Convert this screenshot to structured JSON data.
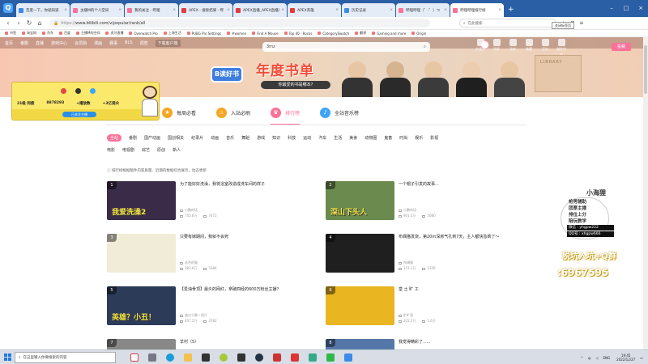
{
  "browser": {
    "tabs": [
      {
        "label": "百度一下，你就知道",
        "fav": "blue"
      },
      {
        "label": "主播M的个人空间",
        "fav": "pink"
      },
      {
        "label": "我的关注 - 哔哩",
        "fav": "pink"
      },
      {
        "label": "APEX - 搜索结果 - 哔",
        "fav": "red"
      },
      {
        "label": "APEX直播_APEX直播间",
        "fav": "red"
      },
      {
        "label": "APEX英雄",
        "fav": "red"
      },
      {
        "label": "历史记录",
        "fav": "blue"
      },
      {
        "label": "哔哩哔哩（゜-゜）つ",
        "fav": "pink"
      },
      {
        "label": "哔哩哔哩排行榜",
        "fav": "pink",
        "active": true
      }
    ],
    "tooltip": "关闭标签页",
    "address_protocol": "https://",
    "address_rest": "www.bilibili.com/v/popular/rank/all",
    "search_placeholder": "在此搜索",
    "bookmarks": [
      "书签",
      "淘宝网",
      "京东",
      "百度",
      "主播M的空间",
      "虎牙直播",
      "Overwatch Pro",
      "上海生活",
      "PUBG Pro Settings",
      "#women",
      "Find A Mouse",
      "Top 40 - Rocks",
      "CategorySwatch",
      "翻译",
      "Gaming and more",
      "Origin"
    ]
  },
  "bili": {
    "nav": [
      "首页",
      "番剧",
      "直播",
      "游戏中心",
      "会员购",
      "漫画",
      "赛事",
      "BLS",
      "调查",
      "下载客户端"
    ],
    "search_query": "3mz",
    "right": [
      "大会员",
      "消息",
      "动态",
      "收藏",
      "历史",
      "创作中心"
    ],
    "upload_label": "投稿",
    "banner": {
      "logo": "B读好书",
      "title": "年度书单",
      "subtitle": "你最爱的书是哪本?",
      "library": "LIBRARY"
    },
    "profile": {
      "stats": [
        "21级 同盘",
        "8878293",
        "+播放数",
        "+3亿观众"
      ],
      "follow": "已关注主播"
    },
    "rank_tabs": [
      {
        "label": "每周必看",
        "icon": "star-icon",
        "color": "#f5a623"
      },
      {
        "label": "入站必刷",
        "icon": "fire-icon",
        "color": "#f5a623"
      },
      {
        "label": "排行榜",
        "icon": "rank-icon",
        "color": "#fb7299",
        "active": true
      },
      {
        "label": "全站音乐榜",
        "icon": "music-icon",
        "color": "#3da5f5"
      }
    ],
    "categories_row1": [
      "全站",
      "番剧",
      "国产动画",
      "国创相关",
      "纪录片",
      "动画",
      "音乐",
      "舞蹈",
      "游戏",
      "知识",
      "科技",
      "运动",
      "汽车",
      "生活",
      "美食",
      "动物圈",
      "鬼畜",
      "时尚",
      "娱乐",
      "影视"
    ],
    "categories_row2": [
      "电影",
      "电视剧",
      "综艺",
      "原创",
      "新人"
    ],
    "notice": "排行榜根据稿件内容质量、近期的数据综合展示，动态更新",
    "videos": [
      {
        "rank": "1",
        "title": "为了能好好洗澡，我将浴室改造成洗车间的样子",
        "thumb_text": "我爱洗澡2",
        "up": "小鹏的话",
        "views": "745.8万",
        "danmaku": "7472",
        "bg": "#3a2b48"
      },
      {
        "rank": "2",
        "title": "一个帽子引发的故事...",
        "thumb_text": "深山下头人",
        "up": "小鹏的话",
        "views": "901.3万",
        "danmaku": "5080",
        "bg": "#6b8a4e"
      },
      {
        "rank": "3",
        "title": "只要有嫁期间，我就不会死",
        "thumb_text": "",
        "up": "适合的猫",
        "views": "383.6万",
        "danmaku": "5384",
        "bg": "#f0ecd8"
      },
      {
        "rank": "4",
        "title": "布偶猫发烧，第20m深房气孔到7天，主人都快急疯了～",
        "thumb_text": "",
        "up": "布偶猫",
        "views": "151.1万",
        "danmaku": "1326",
        "bg": "#1f1f1f"
      },
      {
        "rank": "5",
        "title": "【爱油骨顶】最炎的网红，拿破四经的600万粉丝主播？",
        "thumb_text": "英雄？小丑！",
        "up": "渡过宁静丨纸片",
        "views": "407.2万",
        "danmaku": "3782",
        "bg": "#2c3b58"
      },
      {
        "rank": "6",
        "title": "皇 土 旷 工",
        "thumb_text": "",
        "up": "旷旷皇",
        "views": "322.2万",
        "danmaku": "1.6万",
        "bg": "#e9b520"
      },
      {
        "rank": "7",
        "title": "羊村（5）",
        "thumb_text": "",
        "up": "",
        "views": "",
        "danmaku": "",
        "bg": "#888"
      },
      {
        "rank": "8",
        "title": "我觉得精彩了......",
        "thumb_text": "",
        "up": "",
        "views": "",
        "danmaku": "",
        "bg": "#5577aa"
      }
    ]
  },
  "overlay": {
    "title": "小海狸",
    "lines": [
      "枪男辅助",
      "团厚主播",
      "排位上分",
      "陪玩教学"
    ],
    "qq1": "微信 : yhgpw222",
    "qq2": "QQ号 : xhgpw666",
    "promo1": "脱坑入坑+Q群",
    "promo2": ":6967595"
  },
  "taskbar": {
    "search_placeholder": "在这里输入你要搜索的内容",
    "lang": "ENG",
    "time": "19:45",
    "date": "2022/12/27"
  }
}
